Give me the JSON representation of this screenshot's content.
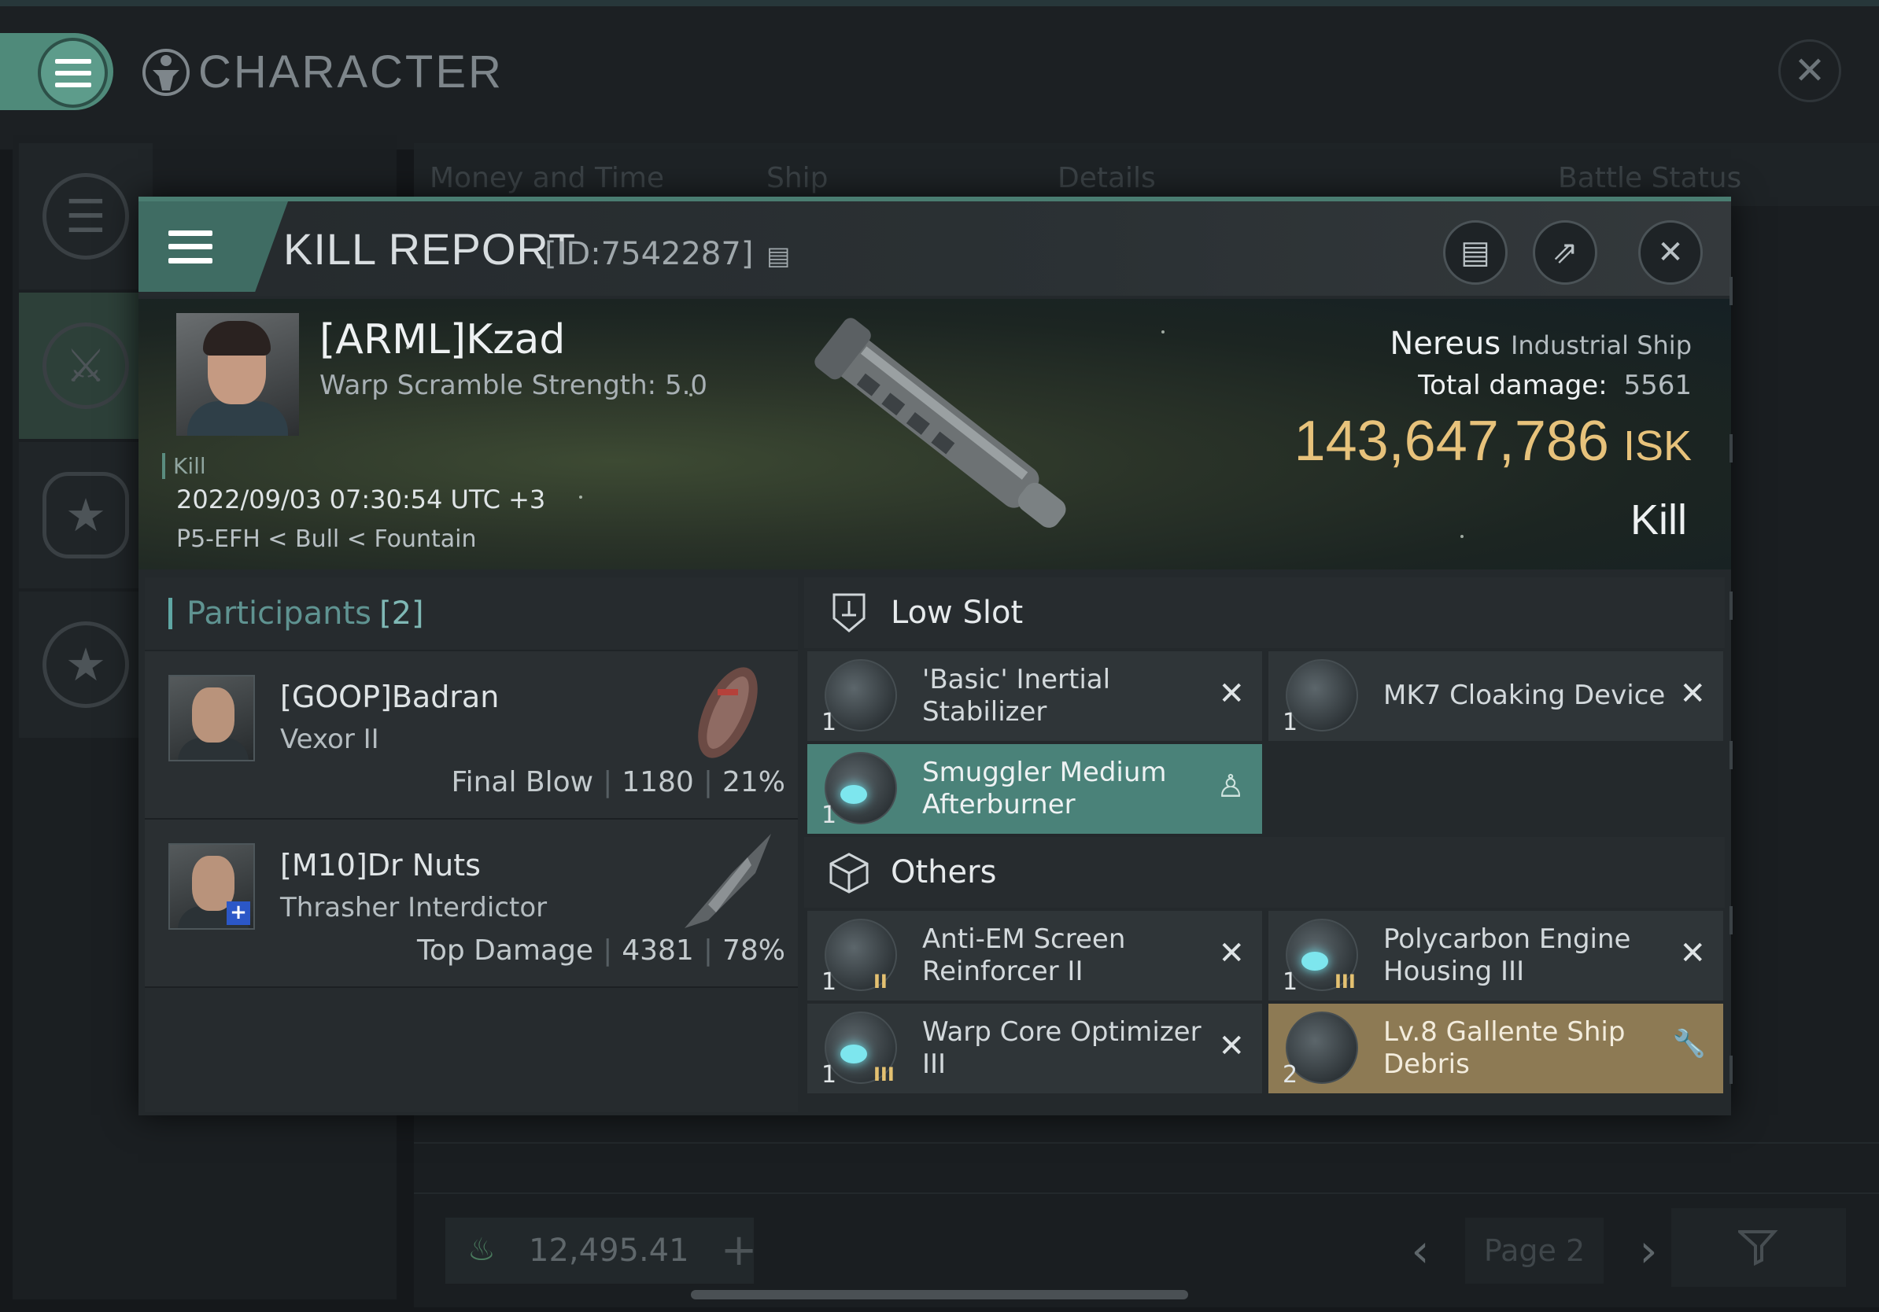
{
  "window": {
    "title": "CHARACTER",
    "close_label": "✕"
  },
  "background": {
    "tabs": [
      "Money and Time",
      "Ship",
      "Details",
      "Battle Status"
    ],
    "wallet_value": "12,495.41",
    "page_label": "Page 2"
  },
  "kill_report": {
    "title": "KILL REPORT",
    "id": "[ID:7542287]",
    "victim": {
      "name": "[ARML]Kzad",
      "warp_scramble": "Warp Scramble Strength: 5.0",
      "tag": "Kill",
      "datetime": "2022/09/03 07:30:54 UTC +3",
      "location": "P5-EFH < Bull < Fountain"
    },
    "ship": {
      "name": "Nereus",
      "class": "Industrial Ship",
      "total_damage_label": "Total damage:",
      "total_damage": "5561",
      "isk_value": "143,647,786",
      "isk_unit": "ISK",
      "result": "Kill"
    },
    "participants": {
      "label": "Participants",
      "count": "[2]",
      "items": [
        {
          "name": "[GOOP]Badran",
          "ship": "Vexor II",
          "role": "Final Blow",
          "damage": "1180",
          "percent": "21%"
        },
        {
          "name": "[M10]Dr Nuts",
          "ship": "Thrasher Interdictor",
          "role": "Top Damage",
          "damage": "4381",
          "percent": "78%"
        }
      ]
    },
    "low_slot": {
      "label": "Low Slot",
      "items": [
        {
          "name": "'Basic' Inertial Stabilizer",
          "qty": "1",
          "meta": "",
          "action": "✕"
        },
        {
          "name": "MK7 Cloaking Device",
          "qty": "1",
          "meta": "",
          "action": "✕"
        },
        {
          "name": "Smuggler Medium Afterburner",
          "qty": "1",
          "meta": "",
          "action": "♙"
        }
      ]
    },
    "others": {
      "label": "Others",
      "items": [
        {
          "name": "Anti-EM Screen Reinforcer II",
          "qty": "1",
          "meta": "II",
          "action": "✕"
        },
        {
          "name": "Polycarbon Engine Housing III",
          "qty": "1",
          "meta": "III",
          "action": "✕"
        },
        {
          "name": "Warp Core Optimizer III",
          "qty": "1",
          "meta": "III",
          "action": "✕"
        },
        {
          "name": "Lv.8 Gallente Ship Debris",
          "qty": "2",
          "meta": "",
          "action": "🔧"
        }
      ]
    }
  },
  "colors": {
    "accent_teal": "#4f8a7a",
    "isk_gold": "#e7c27b",
    "dropped_highlight": "#4a8279",
    "loot_highlight": "#8d7a54"
  }
}
